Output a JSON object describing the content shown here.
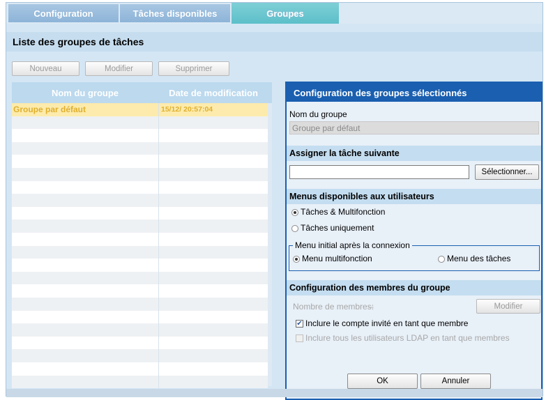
{
  "tabs": [
    {
      "label": "Configuration"
    },
    {
      "label": "Tâches disponibles"
    },
    {
      "label": "Groupes"
    }
  ],
  "list": {
    "title": "Liste des groupes de tâches",
    "buttons": {
      "new": "Nouveau",
      "edit": "Modifier",
      "delete": "Supprimer"
    },
    "columns": {
      "name": "Nom du groupe",
      "date": "Date de modification"
    },
    "rows": [
      {
        "name": "Groupe par défaut",
        "date": "15/12/        20:57:04",
        "selected": true
      }
    ]
  },
  "panel": {
    "title": "Configuration des groupes sélectionnés",
    "group_name_label": "Nom du groupe",
    "group_name_value": "Groupe par défaut",
    "assign_section": "Assigner la tâche suivante",
    "assign_value": "",
    "select_button": "Sélectionner...",
    "menus_section": "Menus disponibles aux utilisateurs",
    "menu_options": [
      {
        "label": "Tâches & Multifonction",
        "checked": true
      },
      {
        "label": "Tâches uniquement",
        "checked": false
      }
    ],
    "initial_menu_legend": "Menu initial après la connexion",
    "initial_menu_options": [
      {
        "label": "Menu multifonction",
        "checked": true
      },
      {
        "label": "Menu des tâches",
        "checked": false
      }
    ],
    "members_section": "Configuration des membres du groupe",
    "members_count_label": "Nombre de membres:",
    "members_count_value": "--",
    "members_edit_button": "Modifier",
    "guest_checkbox": {
      "label": "Inclure le compte invité en tant que membre",
      "checked": true
    },
    "ldap_checkbox": {
      "label": "Inclure tous les utilisateurs LDAP en tant que membres",
      "checked": false
    },
    "ok_button": "OK",
    "cancel_button": "Annuler"
  },
  "colors": {
    "accent": "#1a5fb0",
    "selected_row": "#fcebac",
    "active_tab": "#5bbfc9"
  }
}
